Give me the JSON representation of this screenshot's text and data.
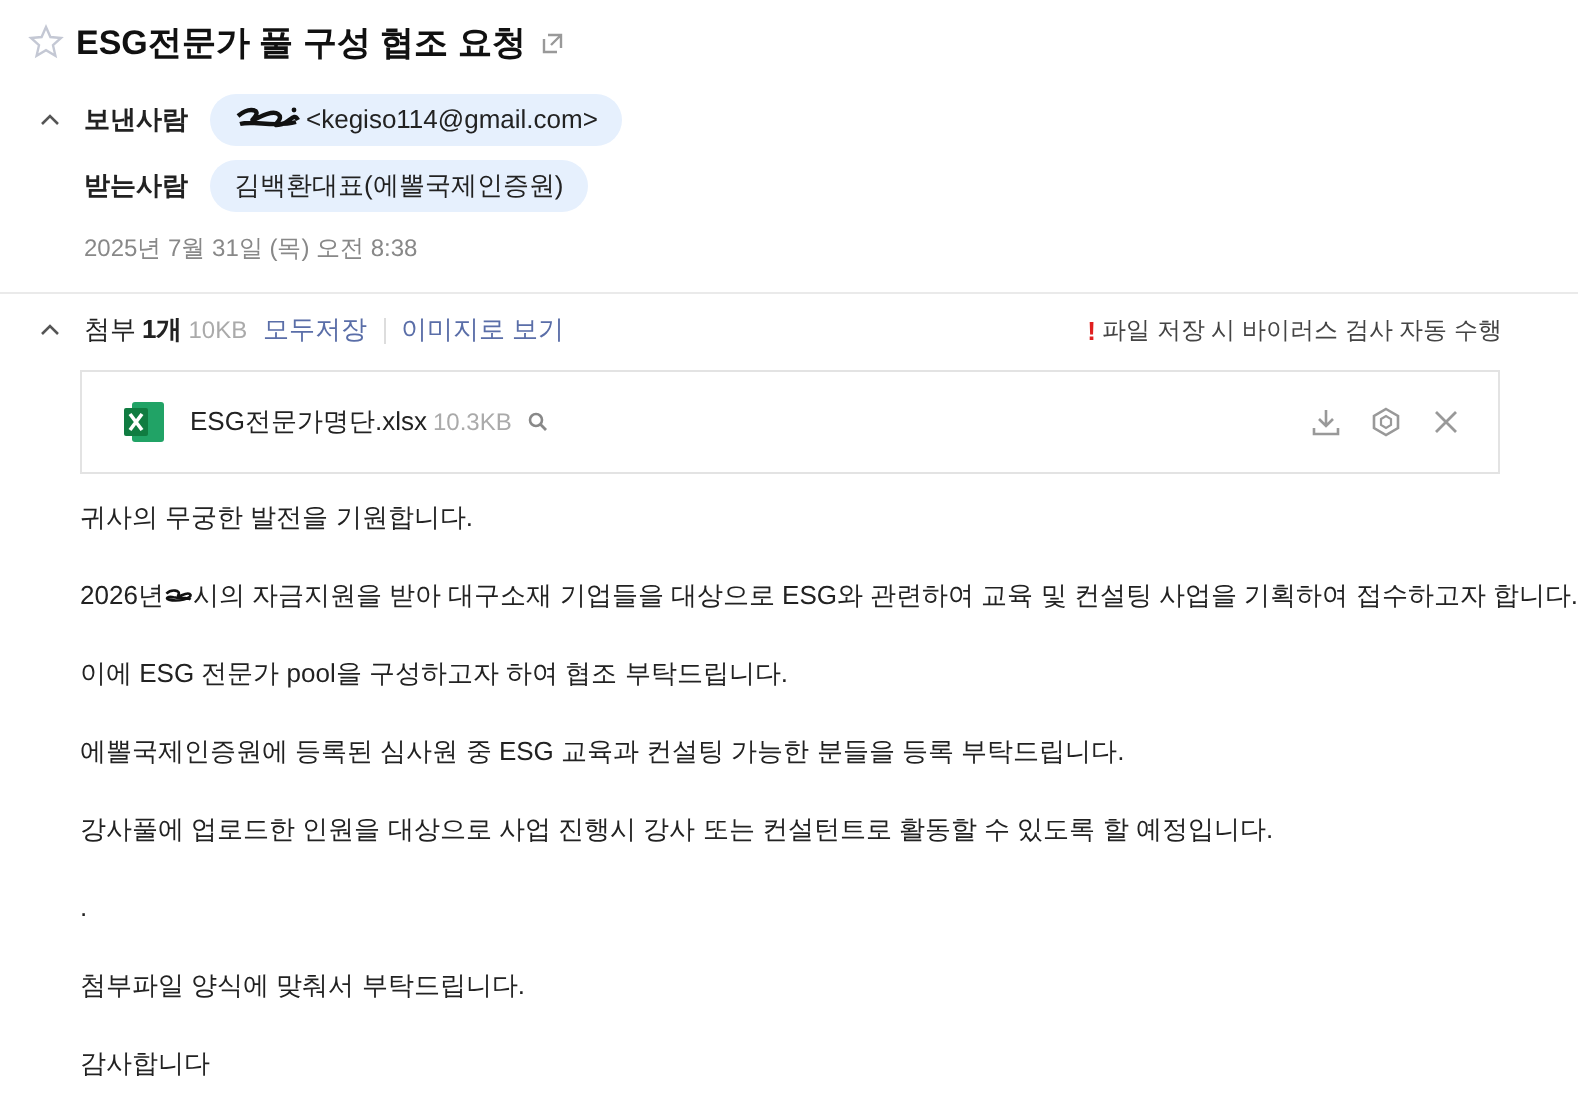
{
  "title": "ESG전문가 풀 구성 협조 요청",
  "starred": false,
  "header": {
    "expanded": true,
    "sender": {
      "label": "보낸사람",
      "address": "<kegiso114@gmail.com>"
    },
    "recipient": {
      "label": "받는사람",
      "name": "김백환대표(에뽈국제인증원)"
    },
    "date": "2025년 7월 31일 (목) 오전 8:38"
  },
  "attachments": {
    "expanded": true,
    "label": "첨부",
    "count": "1개",
    "size": "10KB",
    "save_all": "모두저장",
    "view_as_image": "이미지로 보기",
    "notice_mark": "!",
    "notice": "파일 저장 시 바이러스 검사 자동 수행",
    "files": [
      {
        "name": "ESG전문가명단.xlsx",
        "size": "10.3KB"
      }
    ]
  },
  "body": [
    {
      "kind": "text",
      "text": "귀사의 무궁한 발전을 기원합니다."
    },
    {
      "kind": "redacted",
      "before": "2026년",
      "after": "시의 자금지원을 받아 대구소재 기업들을 대상으로 ESG와 관련하여 교육 및 컨설팅 사업을 기획하여 접수하고자 합니다."
    },
    {
      "kind": "text",
      "text": "이에 ESG 전문가 pool을 구성하고자 하여 협조 부탁드립니다."
    },
    {
      "kind": "text",
      "text": "에뽈국제인증원에 등록된 심사원 중 ESG 교육과 컨설팅 가능한 분들을 등록 부탁드립니다."
    },
    {
      "kind": "text",
      "text": "강사풀에 업로드한 인원을 대상으로 사업 진행시 강사 또는 컨설턴트로 활동할 수 있도록 할 예정입니다."
    },
    {
      "kind": "text",
      "text": "."
    },
    {
      "kind": "text",
      "text": "첨부파일 양식에 맞춰서 부탁드립니다."
    },
    {
      "kind": "text",
      "text": "감사합니다"
    }
  ]
}
